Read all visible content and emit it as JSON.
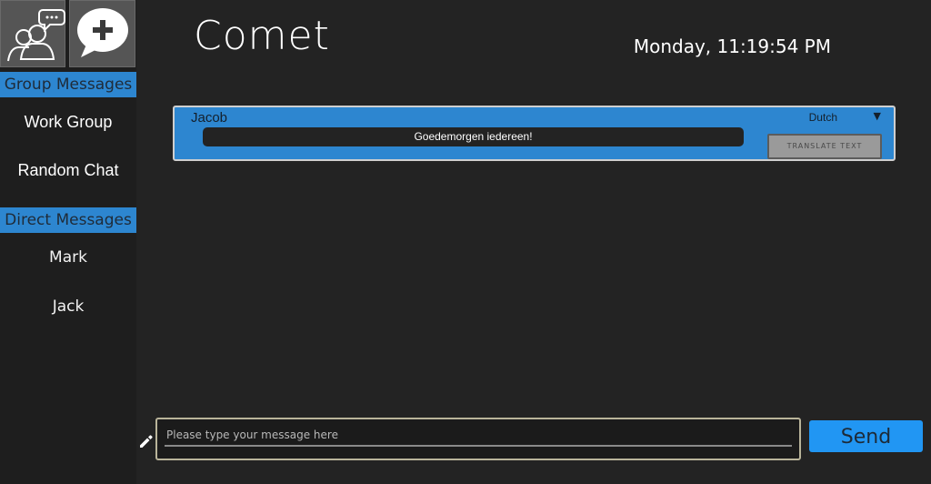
{
  "app": {
    "title": "Comet",
    "datetime": "Monday, 11:19:54 PM"
  },
  "sidebar": {
    "top_buttons": [
      {
        "icon": "group-chat-icon"
      },
      {
        "icon": "new-message-icon"
      }
    ],
    "group_header": "Group Messages",
    "groups": [
      {
        "label": "Work Group"
      },
      {
        "label": "Random Chat"
      }
    ],
    "direct_header": "Direct Messages",
    "directs": [
      {
        "label": "Mark"
      },
      {
        "label": "Jack"
      }
    ]
  },
  "message": {
    "sender": "Jacob",
    "language": "Dutch",
    "language_arrow": "▼",
    "text": "Goedemorgen iedereen!",
    "translate_label": "TRANSLATE TEXT"
  },
  "composer": {
    "placeholder": "Please type your message here",
    "value": "",
    "send_label": "Send",
    "icon": "pencil-icon"
  },
  "colors": {
    "accent": "#2d86d0",
    "send": "#2196f3",
    "background": "#232323",
    "sidebar": "#1e1e1e"
  }
}
